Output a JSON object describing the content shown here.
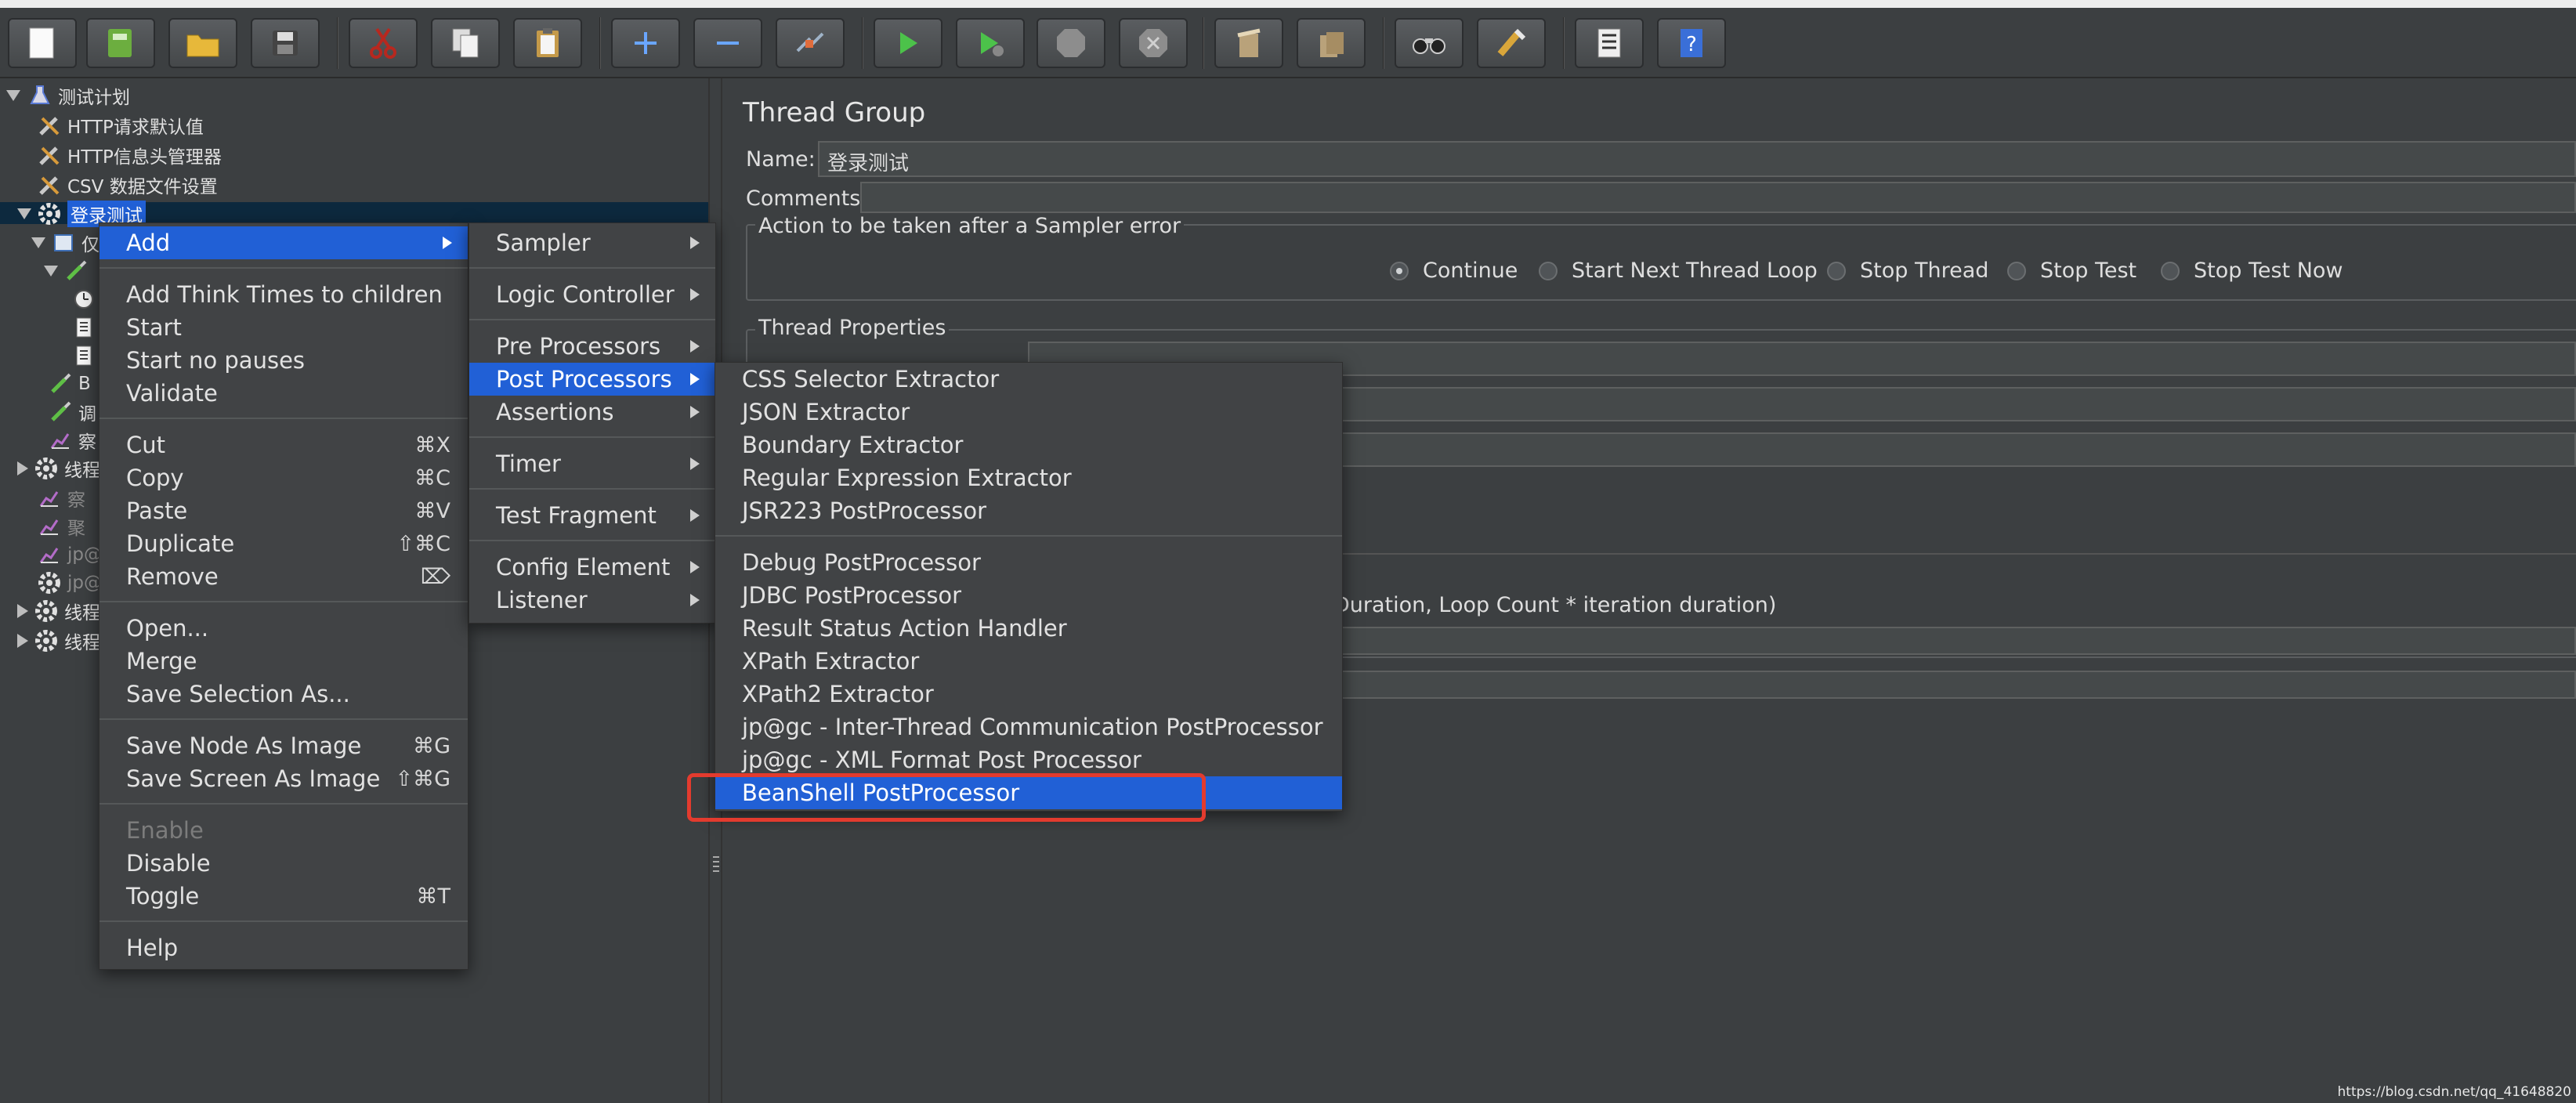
{
  "toolbar": {
    "buttons": [
      "new-icon",
      "template-icon",
      "open-icon",
      "save-icon",
      "cut-icon",
      "copy-icon",
      "paste-icon",
      "expand-icon",
      "collapse-icon",
      "toggle-icon",
      "start-icon",
      "start-no-pauses-icon",
      "stop-icon",
      "shutdown-icon",
      "clear-icon",
      "clear-all-icon",
      "search-icon",
      "reset-search-icon",
      "function-helper-icon",
      "help-icon"
    ]
  },
  "tree": {
    "plan": "测试计划",
    "http_defaults": "HTTP请求默认值",
    "header_manager": "HTTP信息头管理器",
    "csv_config": "CSV 数据文件设置",
    "selected_group": "登录测试",
    "stub_1": "仅",
    "stub_b": "B",
    "stub_2": "调",
    "stub_3": "察",
    "thread_group_a": "线程",
    "stub_4": "察",
    "stub_5": "聚",
    "stub_jp1": "jp@",
    "stub_jp2": "jp@",
    "thread_group_b": "线程",
    "thread_group_c": "线程"
  },
  "main": {
    "title": "Thread Group",
    "name_label": "Name:",
    "name_value": "登录测试",
    "comments_label": "Comments:",
    "error_group_label": "Action to be taken after a Sampler error",
    "error_options": [
      "Continue",
      "Start Next Thread Loop",
      "Stop Thread",
      "Stop Test",
      "Stop Test Now"
    ],
    "error_selected": "Continue",
    "thread_props_label": "Thread Properties",
    "duration_fragment": "Duration, Loop Count * iteration duration)"
  },
  "context_menu": {
    "items": {
      "add": "Add",
      "add_think_times": "Add Think Times to children",
      "start": "Start",
      "start_no_pauses": "Start no pauses",
      "validate": "Validate",
      "cut": "Cut",
      "cut_sc": "⌘X",
      "copy": "Copy",
      "copy_sc": "⌘C",
      "paste": "Paste",
      "paste_sc": "⌘V",
      "duplicate": "Duplicate",
      "duplicate_sc": "⇧⌘C",
      "remove": "Remove",
      "remove_sc": "⌦",
      "open": "Open...",
      "merge": "Merge",
      "save_selection": "Save Selection As...",
      "save_node_image": "Save Node As Image",
      "save_node_image_sc": "⌘G",
      "save_screen_image": "Save Screen As Image",
      "save_screen_image_sc": "⇧⌘G",
      "enable": "Enable",
      "disable": "Disable",
      "toggle": "Toggle",
      "toggle_sc": "⌘T",
      "help": "Help"
    }
  },
  "add_menu": {
    "sampler": "Sampler",
    "logic_controller": "Logic Controller",
    "pre_processors": "Pre Processors",
    "post_processors": "Post Processors",
    "assertions": "Assertions",
    "timer": "Timer",
    "test_fragment": "Test Fragment",
    "config_element": "Config Element",
    "listener": "Listener"
  },
  "post_menu": {
    "css": "CSS Selector Extractor",
    "json": "JSON Extractor",
    "boundary": "Boundary Extractor",
    "regex": "Regular Expression Extractor",
    "jsr223": "JSR223 PostProcessor",
    "debug": "Debug PostProcessor",
    "jdbc": "JDBC PostProcessor",
    "result_status": "Result Status Action Handler",
    "xpath": "XPath Extractor",
    "xpath2": "XPath2 Extractor",
    "inter_thread": "jp@gc - Inter-Thread Communication PostProcessor",
    "xml_format": "jp@gc - XML Format Post Processor",
    "beanshell": "BeanShell PostProcessor"
  },
  "colors": {
    "highlight": "#2160d6",
    "annotation_box": "#e33b2e",
    "background": "#3c3f41"
  },
  "watermark": "https://blog.csdn.net/qq_41648820"
}
